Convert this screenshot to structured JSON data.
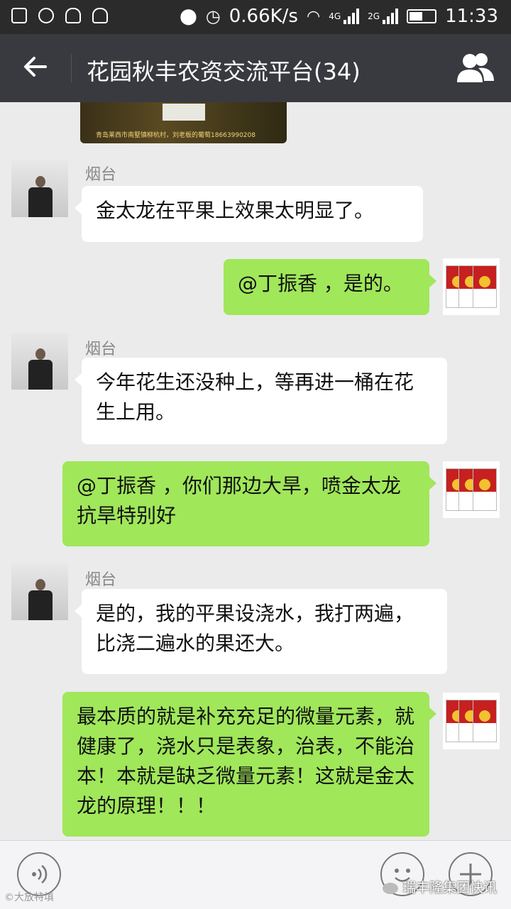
{
  "status_bar": {
    "speed": "0.66K/s",
    "net_4g": "4G",
    "net_2g": "2G",
    "time": "11:33"
  },
  "nav": {
    "title": "花园秋丰农资交流平台(34)"
  },
  "top_image": {
    "caption": "青岛莱西市南墅镇柳杭村，刘老板的葡萄18663990208"
  },
  "messages": [
    {
      "side": "in",
      "sender": "烟台",
      "text": "金太龙在平果上效果太明显了。"
    },
    {
      "side": "out",
      "text": "@丁振香 ，是的。"
    },
    {
      "side": "in",
      "sender": "烟台",
      "text": "今年花生还没种上，等再进一桶在花生上用。"
    },
    {
      "side": "out",
      "text": "@丁振香 ，你们那边大旱，喷金太龙抗旱特别好"
    },
    {
      "side": "in",
      "sender": "烟台",
      "text": "是的，我的平果设浇水，我打两遍，比浇二遍水的果还大。"
    },
    {
      "side": "out",
      "text": "最本质的就是补充充足的微量元素，就健康了，浇水只是表象，治表，不能治本！本就是缺乏微量元素！这就是金太龙的原理！！！"
    }
  ],
  "watermarks": {
    "left": "©大放特填",
    "right": "瑞丰隆集团快讯"
  }
}
